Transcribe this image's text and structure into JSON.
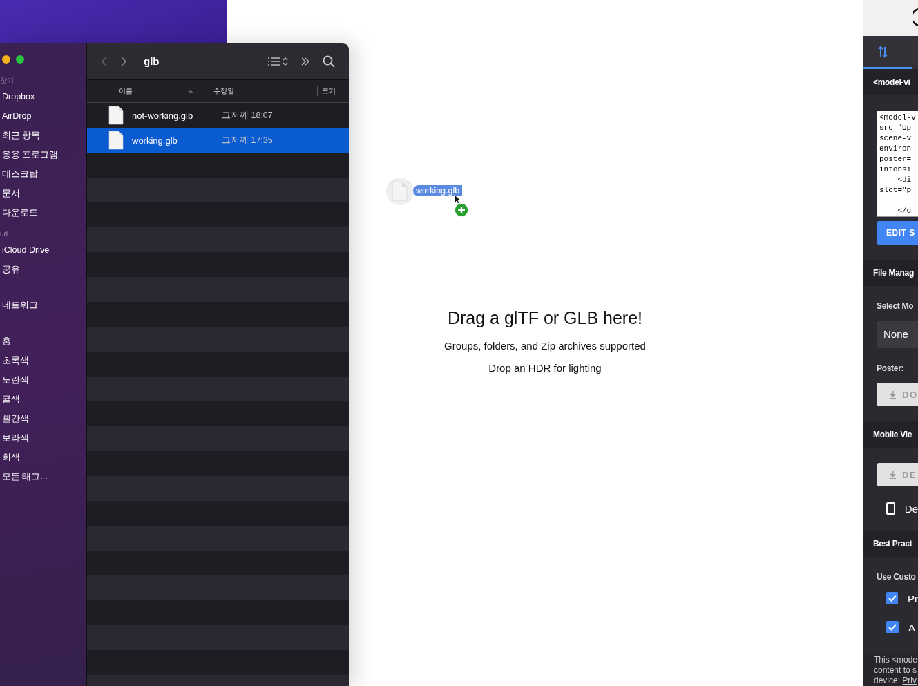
{
  "finder": {
    "title": "glb",
    "sidebar": [
      {
        "heading": "찾기",
        "items": [
          "Dropbox",
          "AirDrop",
          "최근 항목",
          "응용 프로그램",
          "데스크탑",
          "문서",
          "다운로드"
        ]
      },
      {
        "heading": "ud",
        "items": [
          "iCloud Drive",
          "공유"
        ]
      },
      {
        "items": [
          "네트워크"
        ]
      },
      {
        "items": [
          "홈",
          "초록색",
          "노란색",
          "귤색",
          "빨간색",
          "보라색",
          "회색",
          "모든 태그..."
        ]
      }
    ],
    "columns": [
      "이름",
      "수정일",
      "크기"
    ],
    "rows": [
      {
        "name": "not-working.glb",
        "date": "그저께 18:07",
        "selected": false
      },
      {
        "name": "working.glb",
        "date": "그저께 17:35",
        "selected": true
      }
    ]
  },
  "drag": {
    "label": "working.glb"
  },
  "drop_zone": {
    "title": "Drag a glTF or GLB here!",
    "subtitle": "Groups, folders, and Zip archives supported",
    "hint": "Drop an HDR for lighting"
  },
  "panel": {
    "tab": {
      "selected": true
    },
    "sections": [
      {
        "kind": "header",
        "text": "<model-vi"
      },
      {
        "kind": "code",
        "text": "<model-v\nsrc=\"Up\nscene-v\nenviron\nposter=\nintensi\n    <di\nslot=\"p\n\n    </d"
      },
      {
        "kind": "primary",
        "text": "EDIT S"
      },
      {
        "kind": "header",
        "text": "File Manag"
      },
      {
        "kind": "label",
        "text": "Select Mo"
      },
      {
        "kind": "select",
        "text": "None"
      },
      {
        "kind": "label",
        "text": "Poster:"
      },
      {
        "kind": "download",
        "text": "DO"
      },
      {
        "kind": "header",
        "text": "Mobile Vie"
      },
      {
        "kind": "download",
        "text": "DE"
      },
      {
        "kind": "checkbox",
        "text": "De",
        "checked": false
      },
      {
        "kind": "header",
        "text": "Best Pract"
      },
      {
        "kind": "label",
        "text": "Use Custo"
      },
      {
        "kind": "checkbox",
        "text": "Pr",
        "checked": true
      },
      {
        "kind": "checkbox",
        "text": "A",
        "checked": true
      }
    ],
    "footer": {
      "lines": [
        "This <mode",
        "content to s"
      ],
      "text": "device: ",
      "link": "Priv"
    }
  }
}
